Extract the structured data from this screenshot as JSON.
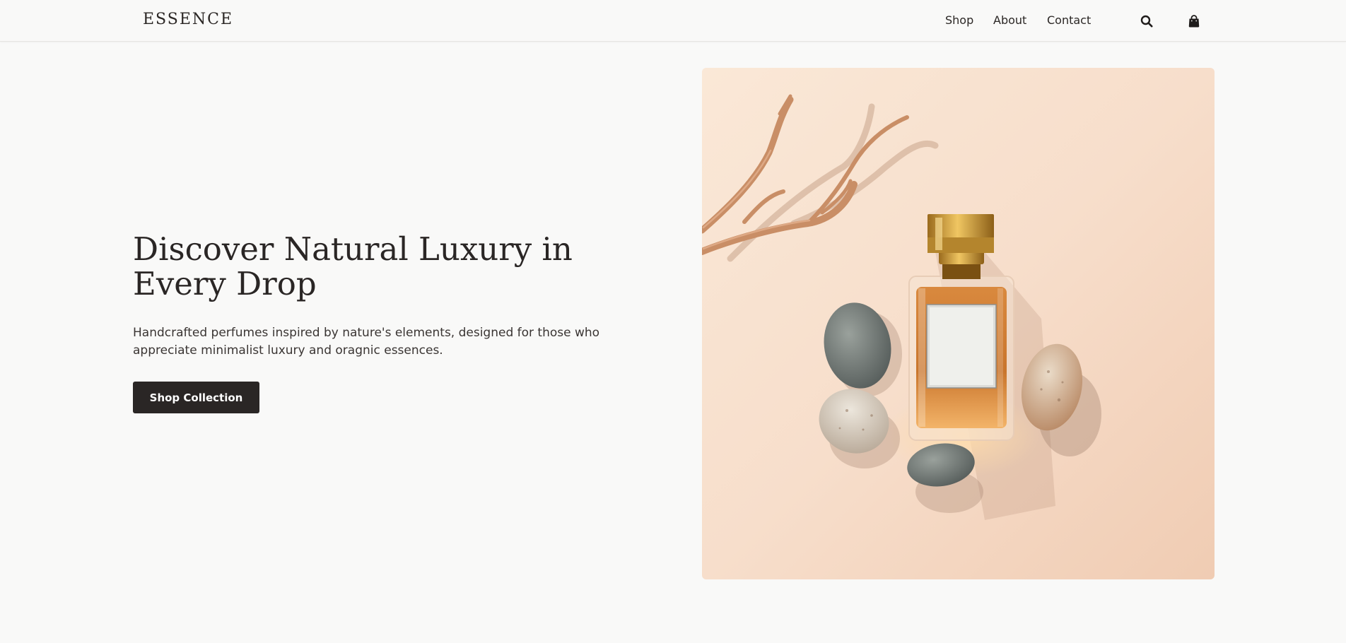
{
  "header": {
    "logo": "ESSENCE",
    "nav": [
      {
        "label": "Shop"
      },
      {
        "label": "About"
      },
      {
        "label": "Contact"
      }
    ],
    "icons": {
      "search": "search-icon",
      "cart": "shopping-bag-icon"
    }
  },
  "hero": {
    "title": "Discover Natural Luxury in Every Drop",
    "subtitle": "Handcrafted perfumes inspired by nature's elements, designed for those who appreciate minimalist luxury and oragnic essences.",
    "cta_label": "Shop Collection",
    "image": "perfume-bottle-with-stones-and-driftwood"
  },
  "colors": {
    "background": "#f9f9f8",
    "text": "#2a2625",
    "button": "#2a2625",
    "image_bg": "#f7decb"
  }
}
